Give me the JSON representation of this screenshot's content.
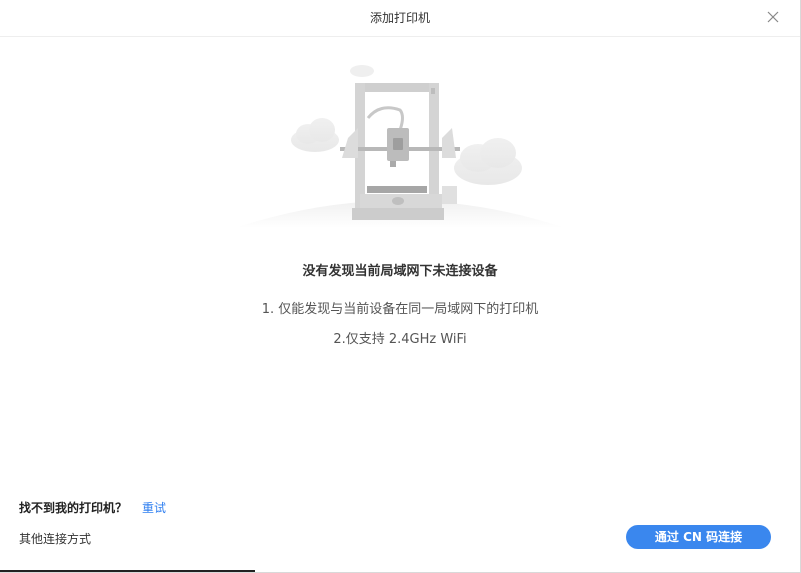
{
  "dialog": {
    "title": "添加打印机"
  },
  "empty_state": {
    "heading": "没有发现当前局域网下未连接设备",
    "line1": "1. 仅能发现与当前设备在同一局域网下的打印机",
    "line2": "2.仅支持 2.4GHz WiFi",
    "illustration": "3d-printer-illustration"
  },
  "footer": {
    "not_found_text": "找不到我的打印机？",
    "retry_label": "重试",
    "other_methods_label": "其他连接方式",
    "cn_connect_label": "通过 CN 码连接"
  },
  "colors": {
    "accent": "#3a87ee",
    "link": "#2f7ff0"
  }
}
